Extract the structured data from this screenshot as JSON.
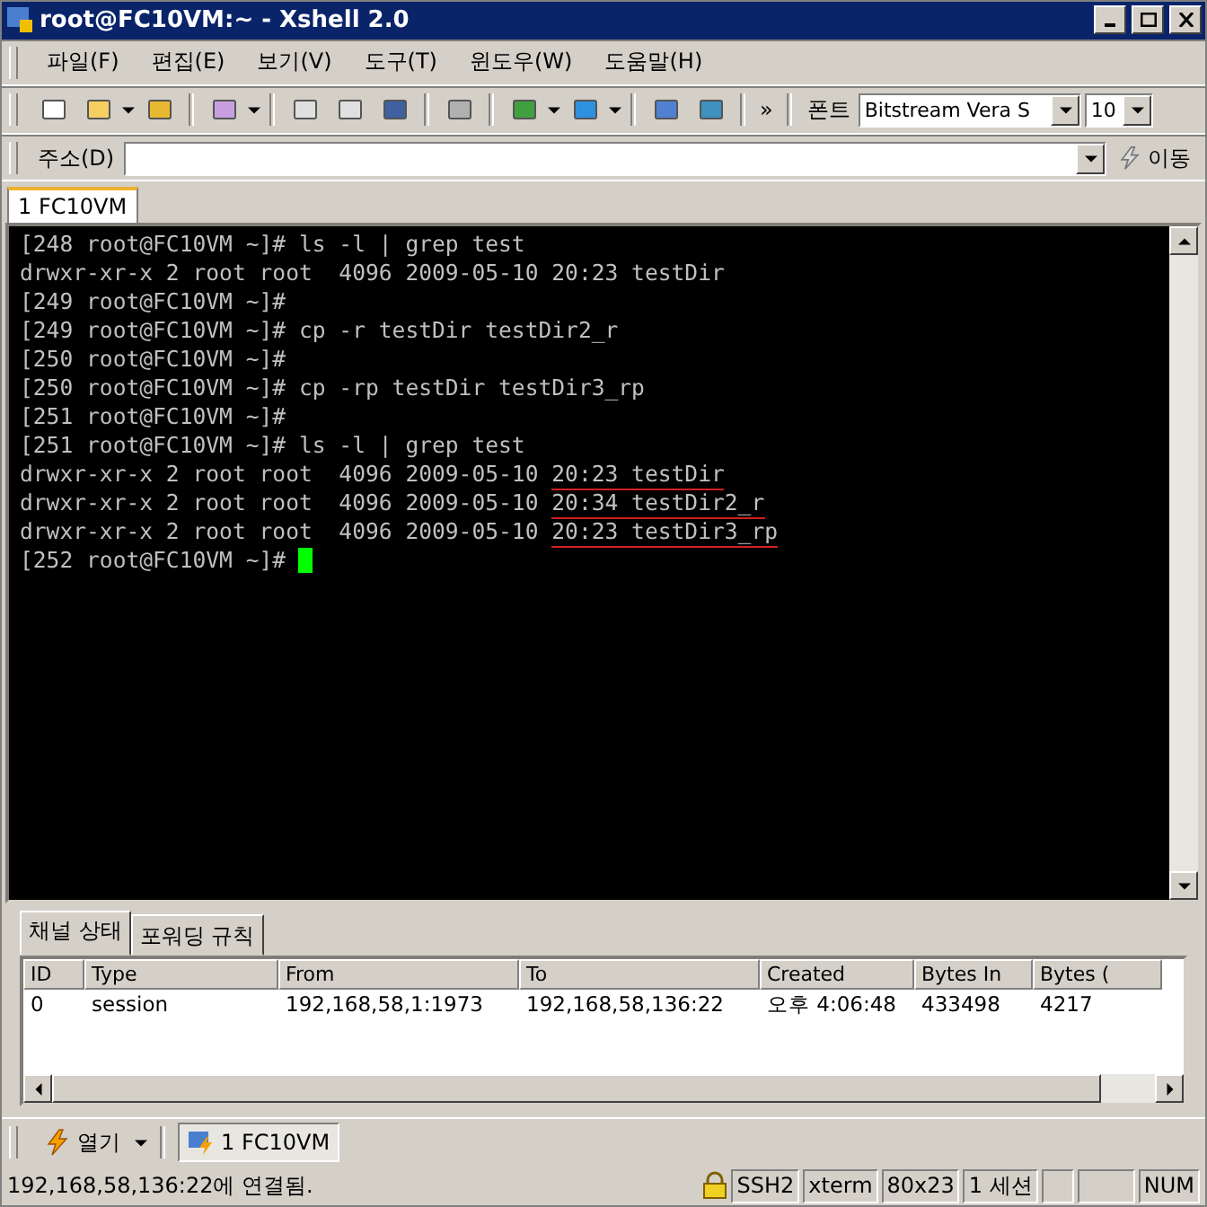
{
  "window": {
    "title": "root@FC10VM:~ - Xshell 2.0"
  },
  "menu": [
    "파일(F)",
    "편집(E)",
    "보기(V)",
    "도구(T)",
    "윈도우(W)",
    "도움말(H)"
  ],
  "toolbar": {
    "more": "»",
    "font_label": "폰트",
    "font": "Bitstream Vera S",
    "size": "10"
  },
  "address": {
    "label": "주소(D)",
    "go": "이동"
  },
  "session_tabs": [
    {
      "label": "1 FC10VM",
      "selected": true
    }
  ],
  "terminal": {
    "lines": [
      {
        "text": "[248 root@FC10VM ~]# ls -l | grep test"
      },
      {
        "text": "drwxr-xr-x 2 root root  4096 2009-05-10 20:23 testDir"
      },
      {
        "text": "[249 root@FC10VM ~]#"
      },
      {
        "text": "[249 root@FC10VM ~]# cp -r testDir testDir2_r"
      },
      {
        "text": "[250 root@FC10VM ~]#"
      },
      {
        "text": "[250 root@FC10VM ~]# cp -rp testDir testDir3_rp"
      },
      {
        "text": "[251 root@FC10VM ~]#"
      },
      {
        "text": "[251 root@FC10VM ~]# ls -l | grep test"
      },
      {
        "text": "drwxr-xr-x 2 root root  4096 2009-05-10 ",
        "marked": "20:23 testDir"
      },
      {
        "text": "drwxr-xr-x 2 root root  4096 2009-05-10 ",
        "marked": "20:34 testDir2_r"
      },
      {
        "text": "drwxr-xr-x 2 root root  4096 2009-05-10 ",
        "marked": "20:23 testDir3_rp"
      },
      {
        "text": "[252 root@FC10VM ~]# ",
        "cursor": true
      }
    ]
  },
  "panel_tabs": [
    {
      "label": "채널 상태",
      "selected": true
    },
    {
      "label": "포워딩 규칙",
      "selected": false
    }
  ],
  "table": {
    "columns": [
      "ID",
      "Type",
      "From",
      "To",
      "Created",
      "Bytes In",
      "Bytes ("
    ],
    "rows": [
      [
        "0",
        "session",
        "192,168,58,1:1973",
        "192,168,58,136:22",
        "오후 4:06:48",
        "433498",
        "4217"
      ]
    ]
  },
  "taskbar": {
    "open": "열기",
    "session": "1 FC10VM"
  },
  "status_bar": {
    "message": "192,168,58,136:22에 연결됨.",
    "panes": [
      "SSH2",
      "xterm",
      "80x23",
      "1 세션",
      "NUM"
    ]
  }
}
